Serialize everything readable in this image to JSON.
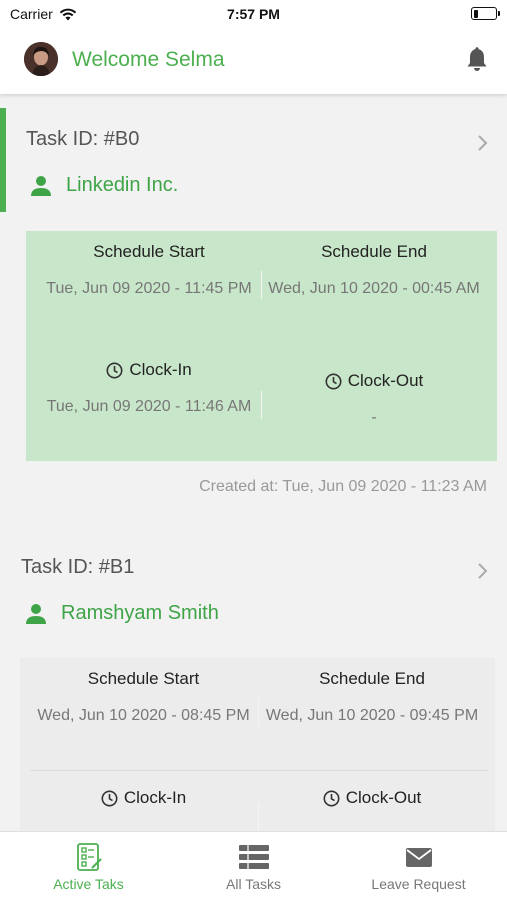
{
  "status_bar": {
    "carrier": "Carrier",
    "time": "7:57 PM",
    "battery_level": 0.2
  },
  "header": {
    "welcome": "Welcome Selma"
  },
  "tasks": [
    {
      "task_id": "Task ID: #B0",
      "client": "Linkedin Inc.",
      "schedule_start_label": "Schedule Start",
      "schedule_start": "Tue, Jun 09 2020 - 11:45 PM",
      "schedule_end_label": "Schedule End",
      "schedule_end": "Wed, Jun 10 2020 - 00:45 AM",
      "clock_in_label": "Clock-In",
      "clock_in": "Tue, Jun 09 2020 - 11:46 AM",
      "clock_out_label": "Clock-Out",
      "clock_out": "-",
      "created": "Created at: Tue, Jun 09 2020 - 11:23 AM"
    },
    {
      "task_id": "Task ID: #B1",
      "client": "Ramshyam Smith",
      "schedule_start_label": "Schedule Start",
      "schedule_start": "Wed, Jun 10 2020 - 08:45 PM",
      "schedule_end_label": "Schedule End",
      "schedule_end": "Wed, Jun 10 2020 - 09:45 PM",
      "clock_in_label": "Clock-In",
      "clock_out_label": "Clock-Out"
    }
  ],
  "tab_bar": {
    "tabs": [
      {
        "label": "Active Taks",
        "icon": "active-tasks-icon"
      },
      {
        "label": "All Tasks",
        "icon": "all-tasks-icon"
      },
      {
        "label": "Leave Request",
        "icon": "envelope-icon"
      }
    ]
  },
  "colors": {
    "accent": "#4caf50",
    "active_card": "#c8e6c9",
    "card": "#ececec"
  }
}
